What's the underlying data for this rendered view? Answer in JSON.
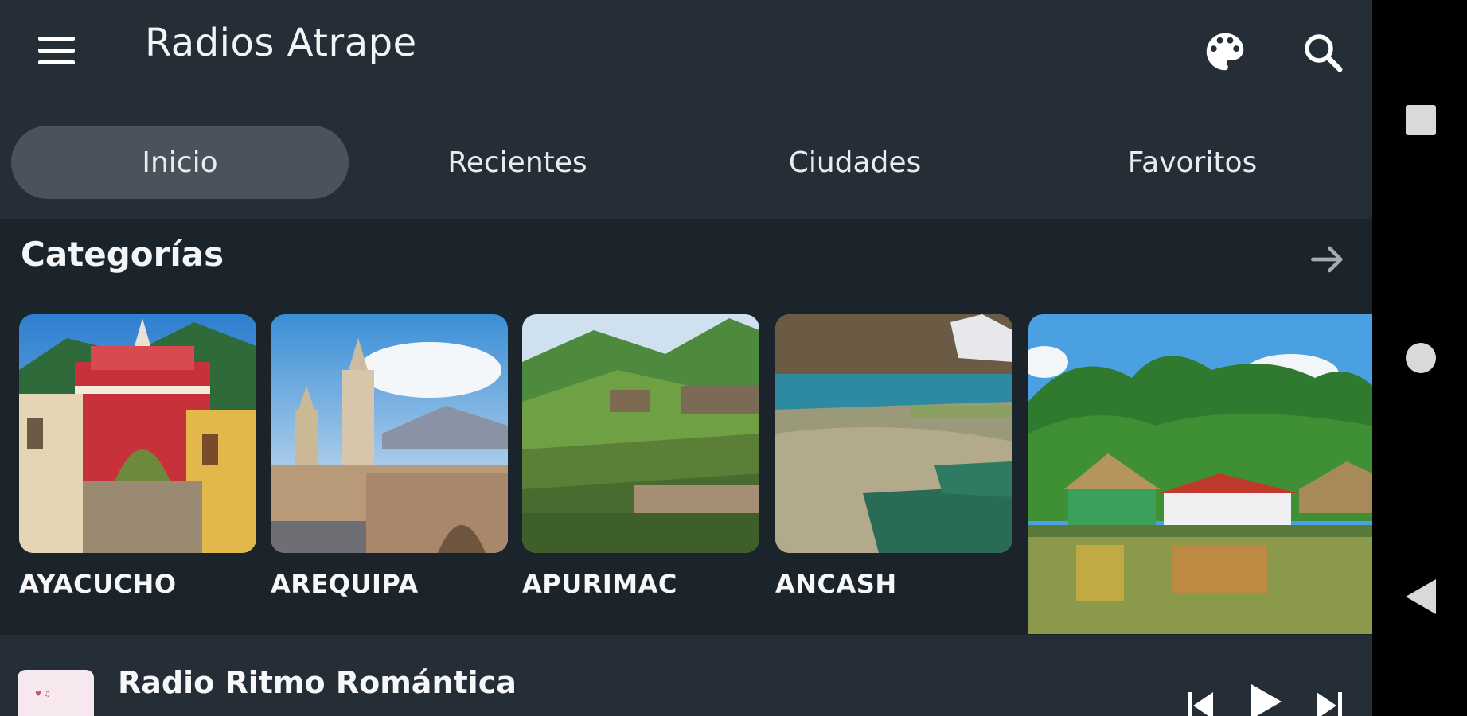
{
  "app": {
    "title": "Radios Atrape"
  },
  "toolbar": {
    "icons": [
      "menu-icon",
      "palette-icon",
      "search-icon"
    ]
  },
  "tabs": [
    {
      "label": "Inicio",
      "active": true
    },
    {
      "label": "Recientes",
      "active": false
    },
    {
      "label": "Ciudades",
      "active": false
    },
    {
      "label": "Favoritos",
      "active": false
    }
  ],
  "categories": {
    "title": "Categorías",
    "items": [
      {
        "label": "AYACUCHO"
      },
      {
        "label": "AREQUIPA"
      },
      {
        "label": "APURIMAC"
      },
      {
        "label": "ANCASH"
      },
      {
        "label": ""
      }
    ]
  },
  "player": {
    "station": "Radio Ritmo Romántica"
  },
  "colors": {
    "background": "#1b232b",
    "appbar": "#252e37",
    "tab_active": "#4a535b",
    "text": "#ffffff"
  }
}
